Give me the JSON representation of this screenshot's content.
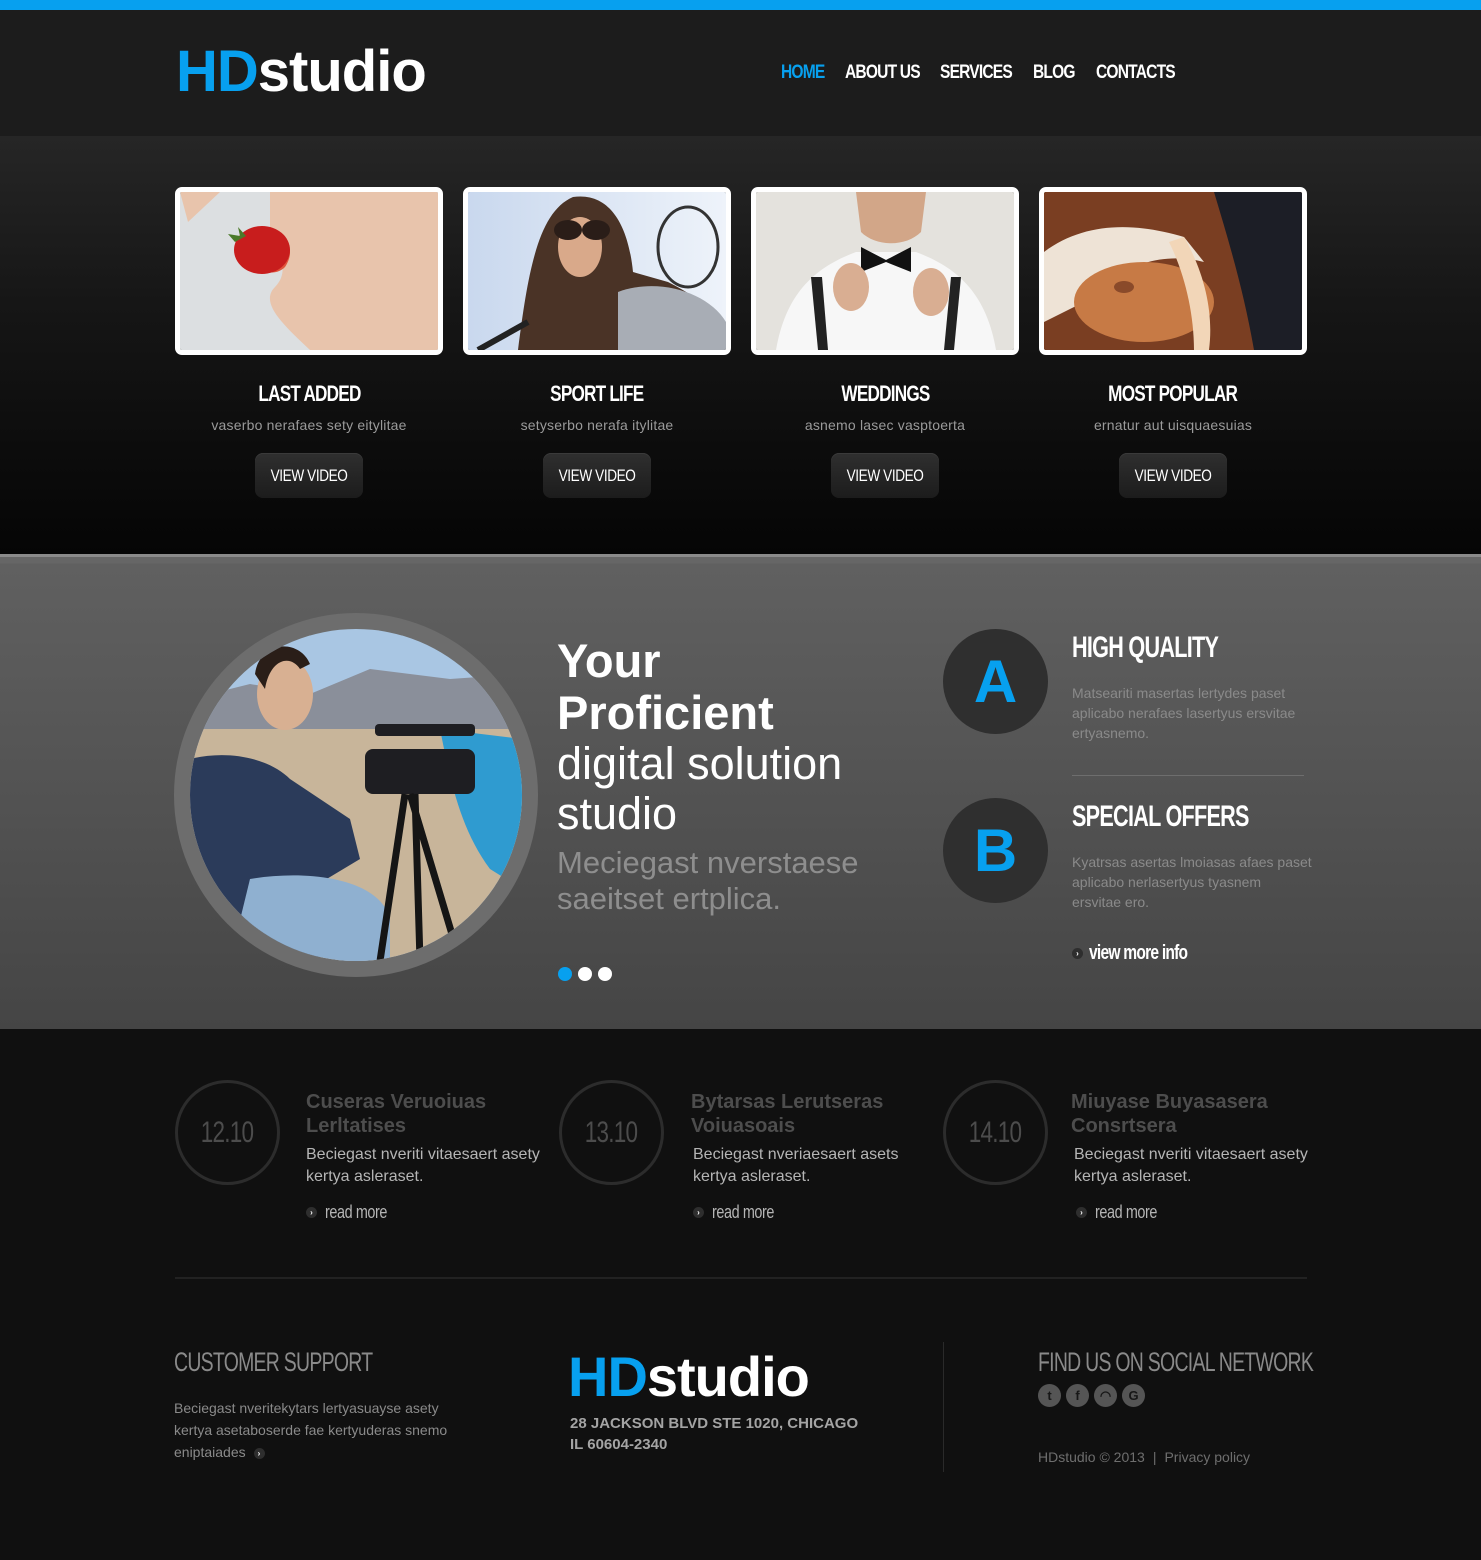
{
  "brand": {
    "prefix": "HD",
    "suffix": "studio",
    "accent_color": "#07a0ef"
  },
  "nav": [
    {
      "label": "HOME",
      "active": true
    },
    {
      "label": "ABOUT US",
      "active": false
    },
    {
      "label": "SERVICES",
      "active": false
    },
    {
      "label": "BLOG",
      "active": false
    },
    {
      "label": "CONTACTS",
      "active": false
    }
  ],
  "gallery": [
    {
      "title": "LAST ADDED",
      "subtitle": "vaserbo nerafaes sety eitylitae",
      "button": "VIEW VIDEO",
      "image": "woman-eating-strawberry"
    },
    {
      "title": "SPORT LIFE",
      "subtitle": "setyserbo nerafa itylitae",
      "button": "VIEW VIDEO",
      "image": "woman-with-tennis-racket"
    },
    {
      "title": "WEDDINGS",
      "subtitle": "asnemo lasec vasptoerta",
      "button": "VIEW VIDEO",
      "image": "man-tying-bow-tie"
    },
    {
      "title": "MOST POPULAR",
      "subtitle": "ernatur aut uisquaesuias",
      "button": "VIEW VIDEO",
      "image": "sunlit-body-closeup"
    }
  ],
  "slider": {
    "image": "cameraman-with-tripod",
    "heading_bold_1": "Your",
    "heading_bold_2": "Proficient",
    "heading_light_1": "digital solution",
    "heading_light_2": "studio",
    "subtext": "Meciegast nverstaese saeitset ertplica.",
    "slides_total": 3,
    "active_slide": 1
  },
  "features": [
    {
      "letter": "A",
      "title": "HIGH QUALITY",
      "description": "Matseariti masertas lertydes paset aplicabo nerafaes lasertyus ersvitae ertyasnemo."
    },
    {
      "letter": "B",
      "title": "SPECIAL OFFERS",
      "description": "Kyatrsas asertas lmoiasas afaes paset aplicabo nerlasertyus tyasnem ersvitae ero."
    }
  ],
  "view_more_label": "view more info",
  "news": [
    {
      "date": "12.10",
      "title": "Cuseras Veruoiuas Lerltatises",
      "description": "Beciegast nveriti vitaesaert asety kertya asleraset.",
      "link": "read more"
    },
    {
      "date": "13.10",
      "title": "Bytarsas Lerutseras Voiuasoais",
      "description": "Beciegast nveriaesaert asets kertya asleraset.",
      "link": "read more"
    },
    {
      "date": "14.10",
      "title": "Miuyase Buyasasera Consrtsera",
      "description": "Beciegast nveriti vitaesaert asety kertya asleraset.",
      "link": "read more"
    }
  ],
  "footer": {
    "support_title": "CUSTOMER SUPPORT",
    "support_text": "Beciegast nveritekytars lertyasuayse asety kertya asetaboserde fae kertyuderas snemo eniptaiades",
    "address_line1": "28 JACKSON BLVD STE 1020, CHICAGO",
    "address_line2": "IL 60604-2340",
    "social_title": "FIND US ON SOCIAL NETWORK",
    "social": [
      {
        "name": "twitter",
        "glyph": "t"
      },
      {
        "name": "facebook",
        "glyph": "f"
      },
      {
        "name": "rss",
        "glyph": "◠"
      },
      {
        "name": "google",
        "glyph": "G"
      }
    ],
    "copyright": "HDstudio © 2013",
    "separator": "|",
    "privacy": "Privacy policy"
  }
}
